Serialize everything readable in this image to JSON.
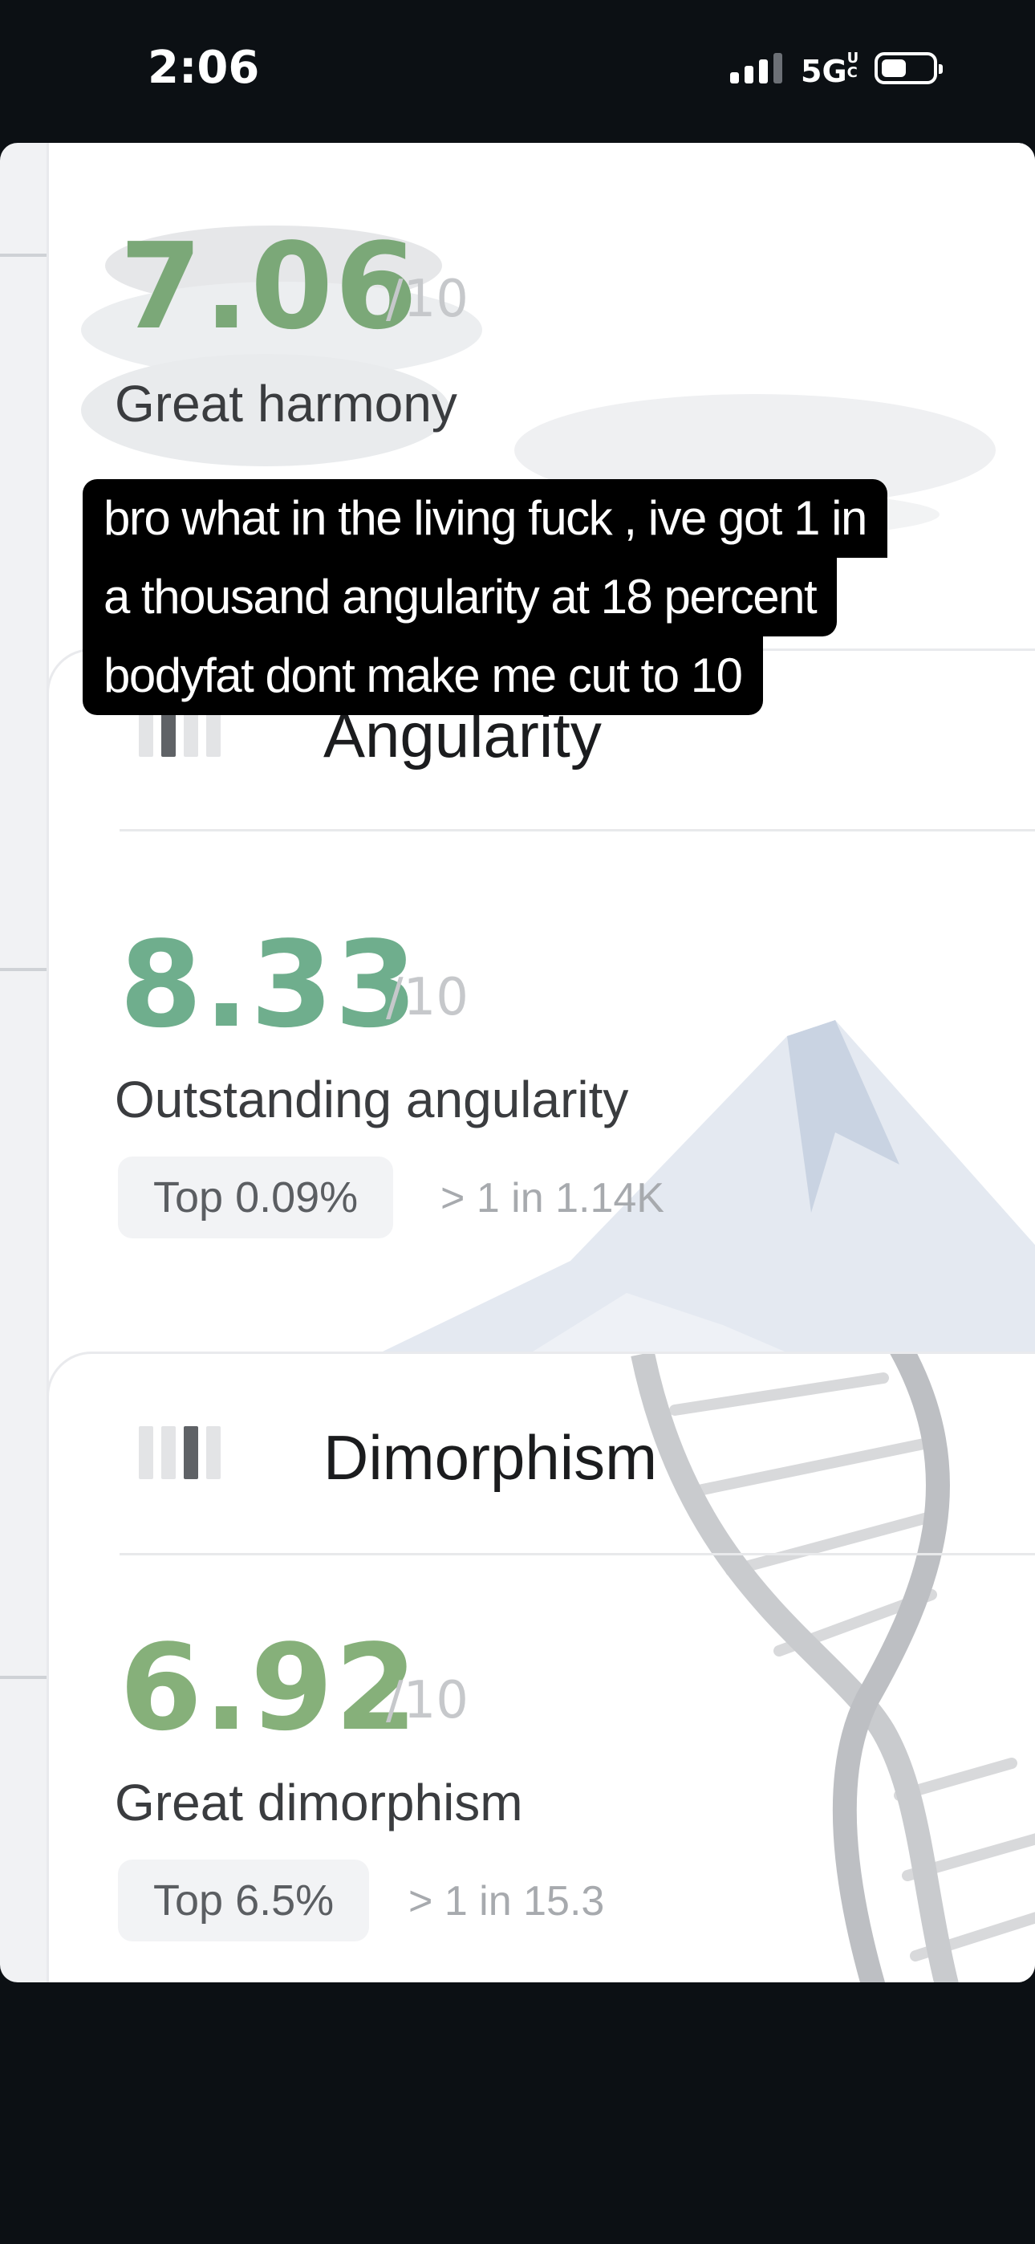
{
  "status_bar": {
    "time": "2:06",
    "network": "5G",
    "network_suffix": "UC"
  },
  "cards": [
    {
      "score": "7.06",
      "out_of": "/10",
      "description": "Great harmony",
      "score_color": "#7ba878"
    },
    {
      "title": "Angularity",
      "level": 2,
      "score": "8.33",
      "out_of": "/10",
      "description": "Outstanding angularity",
      "rank": "Top 0.09%",
      "odds": "> 1 in 1.14K",
      "score_color": "#6fae8d",
      "decoration": "mountain-icon"
    },
    {
      "title": "Dimorphism",
      "level": 3,
      "score": "6.92",
      "out_of": "/10",
      "description": "Great dimorphism",
      "rank": "Top 6.5%",
      "odds": "> 1 in 15.3",
      "score_color": "#86b07a",
      "decoration": "dna-helix-icon"
    }
  ],
  "caption": {
    "lines": [
      "bro what in the living fuck , ive got 1 in",
      "a thousand angularity at 18 percent",
      "bodyfat dont make me cut to 10"
    ]
  }
}
